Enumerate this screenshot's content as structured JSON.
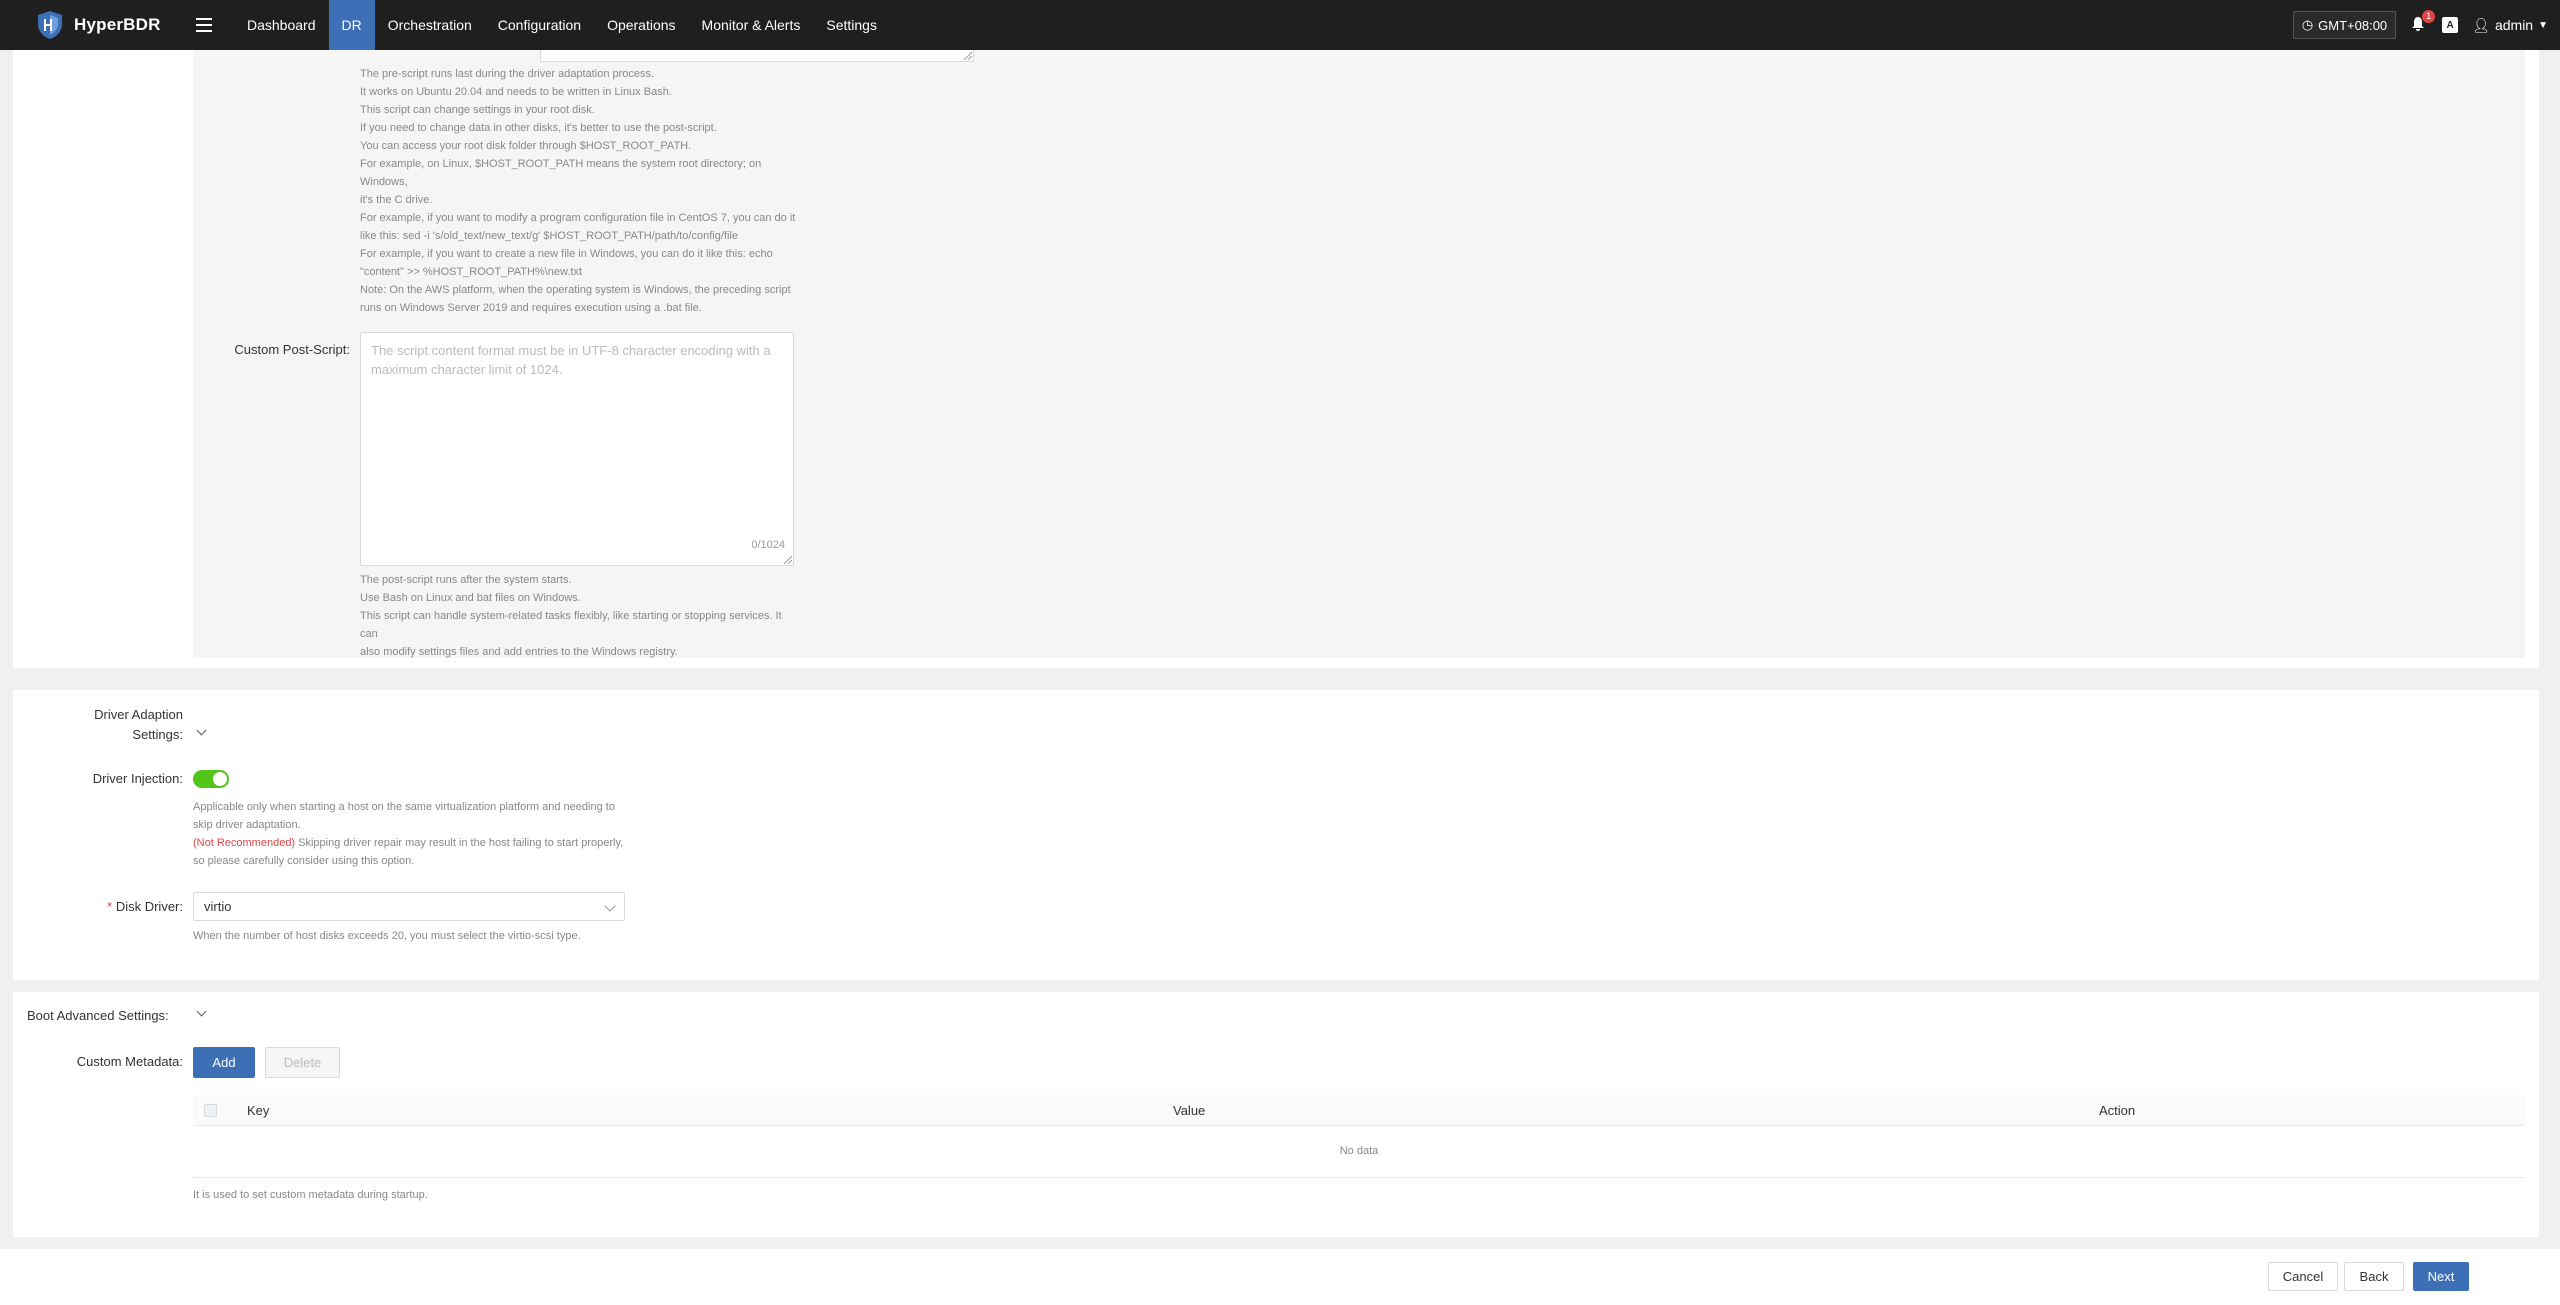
{
  "app": {
    "name": "HyperBDR"
  },
  "nav": {
    "items": [
      {
        "label": "Dashboard",
        "active": false
      },
      {
        "label": "DR",
        "active": true
      },
      {
        "label": "Orchestration",
        "active": false
      },
      {
        "label": "Configuration",
        "active": false
      },
      {
        "label": "Operations",
        "active": false
      },
      {
        "label": "Monitor & Alerts",
        "active": false
      },
      {
        "label": "Settings",
        "active": false
      }
    ],
    "timezone": "GMT+08:00",
    "notification_count": "1",
    "language_icon_text": "A",
    "user": "admin"
  },
  "pre_script": {
    "help_lines": [
      "The pre-script runs last during the driver adaptation process.",
      "It works on Ubuntu 20.04 and needs to be written in Linux Bash.",
      "This script can change settings in your root disk.",
      "If you need to change data in other disks, it's better to use the post-script.",
      "You can access your root disk folder through $HOST_ROOT_PATH.",
      "For example, on Linux, $HOST_ROOT_PATH means the system root directory; on Windows,",
      "it's the C drive.",
      "For example, if you want to modify a program configuration file in CentOS 7, you can do it",
      "like this: sed -i 's/old_text/new_text/g' $HOST_ROOT_PATH/path/to/config/file",
      "For example, if you want to create a new file in Windows, you can do it like this: echo",
      "\"content\" >> %HOST_ROOT_PATH%\\new.txt",
      "Note: On the AWS platform, when the operating system is Windows, the preceding script",
      "runs on Windows Server 2019 and requires execution using a .bat file."
    ]
  },
  "post_script": {
    "label": "Custom Post-Script:",
    "placeholder": "The script content format must be in UTF-8 character encoding with a maximum character limit of 1024.",
    "counter": "0/1024",
    "help_lines": [
      "The post-script runs after the system starts.",
      "Use Bash on Linux and bat files on Windows.",
      "This script can handle system-related tasks flexibly, like starting or stopping services. It can",
      "also modify settings files and add entries to the Windows registry."
    ]
  },
  "driver": {
    "section_label_line1": "Driver Adaption",
    "section_label_line2": "Settings:",
    "injection_label": "Driver Injection:",
    "injection_enabled": true,
    "injection_help_line1": "Applicable only when starting a host on the same virtualization platform and needing to",
    "injection_help_line2": "skip driver adaptation.",
    "not_recommended": "(Not Recommended)",
    "injection_warning_line1": " Skipping driver repair may result in the host failing to start properly,",
    "injection_warning_line2": "so please carefully consider using this option.",
    "disk_driver_required_mark": "*",
    "disk_driver_label": "Disk Driver:",
    "disk_driver_value": "virtio",
    "disk_driver_help": "When the number of host disks exceeds 20, you must select the virtio-scsi type."
  },
  "boot": {
    "section_label": "Boot Advanced Settings:",
    "metadata_label": "Custom Metadata:",
    "add_label": "Add",
    "delete_label": "Delete",
    "columns": [
      "Key",
      "Value",
      "Action"
    ],
    "empty_text": "No data",
    "help": "It is used to set custom metadata during startup."
  },
  "footer": {
    "cancel_label": "Cancel",
    "back_label": "Back",
    "next_label": "Next"
  },
  "colors": {
    "primary": "#3c6fb6",
    "toggle_on": "#52c41a",
    "danger_text": "#e04545",
    "topbar": "#1f1f1f"
  }
}
